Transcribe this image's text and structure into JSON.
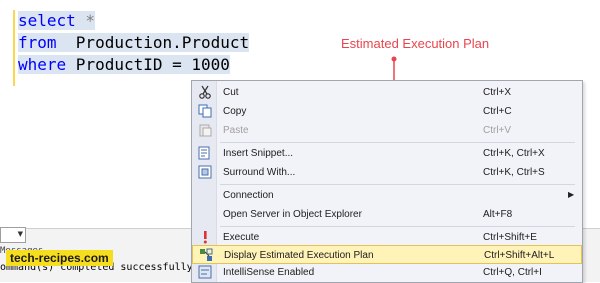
{
  "editor": {
    "lines": [
      {
        "k": "select",
        "rest": " *"
      },
      {
        "k": "from",
        "rest": "  Production.Product"
      },
      {
        "k": "where",
        "rest": " ProductID = 1000"
      }
    ]
  },
  "annotation": {
    "text": "Estimated Execution Plan",
    "color": "#e8454e"
  },
  "context_menu": {
    "items": [
      {
        "label": "Cut",
        "shortcut": "Ctrl+X",
        "icon": "scissors-icon",
        "enabled": true
      },
      {
        "label": "Copy",
        "shortcut": "Ctrl+C",
        "icon": "copy-icon",
        "enabled": true
      },
      {
        "label": "Paste",
        "shortcut": "Ctrl+V",
        "icon": "paste-icon",
        "enabled": false
      },
      {
        "label": "Insert Snippet...",
        "shortcut": "Ctrl+K, Ctrl+X",
        "icon": "snippet-icon",
        "enabled": true
      },
      {
        "label": "Surround With...",
        "shortcut": "Ctrl+K, Ctrl+S",
        "icon": "surround-icon",
        "enabled": true
      },
      {
        "label": "Connection",
        "shortcut": "",
        "icon": "",
        "enabled": true,
        "submenu": true
      },
      {
        "label": "Open Server in Object Explorer",
        "shortcut": "Alt+F8",
        "icon": "",
        "enabled": true
      },
      {
        "label": "Execute",
        "shortcut": "Ctrl+Shift+E",
        "icon": "execute-icon",
        "enabled": true
      },
      {
        "label": "Display Estimated Execution Plan",
        "shortcut": "Ctrl+Shift+Alt+L",
        "icon": "execution-plan-icon",
        "enabled": true,
        "highlighted": true
      },
      {
        "label": "IntelliSense Enabled",
        "shortcut": "Ctrl+Q, Ctrl+I",
        "icon": "intellisense-icon",
        "enabled": true
      }
    ]
  },
  "results": {
    "tab_label": "Messages",
    "message": "ommand(s) completed successfully"
  },
  "watermark": "tech-recipes.com",
  "colors": {
    "highlight": "#fff3b8",
    "highlight_border": "#e4c25a",
    "selection": "#dbe4f1"
  }
}
